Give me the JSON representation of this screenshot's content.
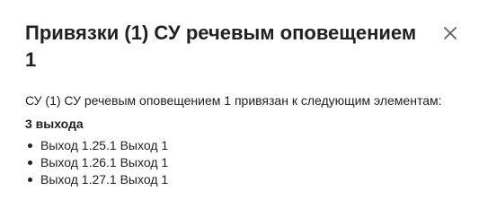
{
  "dialog": {
    "title": "Привязки (1) СУ речевым оповещением 1",
    "close_icon": "close-icon",
    "description": "СУ (1) СУ речевым оповещением 1 привязан к следующим элементам:",
    "section_heading": "3 выхода",
    "items": [
      "Выход 1.25.1 Выход 1",
      "Выход 1.26.1 Выход 1",
      "Выход 1.27.1 Выход 1"
    ]
  }
}
